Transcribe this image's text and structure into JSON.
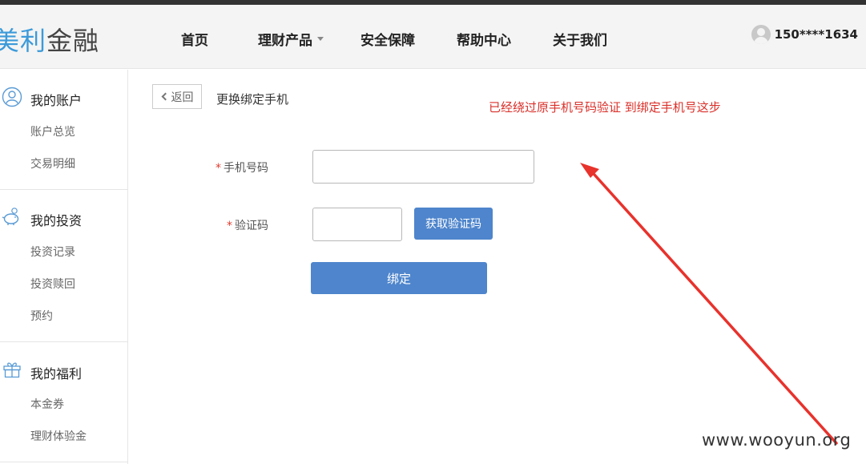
{
  "header": {
    "logo_part1": "美利",
    "logo_part2": "金融",
    "nav": [
      {
        "label": "首页"
      },
      {
        "label": "理财产品"
      },
      {
        "label": "安全保障"
      },
      {
        "label": "帮助中心"
      },
      {
        "label": "关于我们"
      }
    ],
    "user_phone": "150****1634"
  },
  "sidebar": {
    "groups": [
      {
        "title": "我的账户",
        "icon": "user-icon",
        "items": [
          "账户总览",
          "交易明细"
        ]
      },
      {
        "title": "我的投资",
        "icon": "piggy-bank-icon",
        "items": [
          "投资记录",
          "投资赎回",
          "预约"
        ]
      },
      {
        "title": "我的福利",
        "icon": "gift-icon",
        "items": [
          "本金券",
          "理财体验金"
        ]
      }
    ]
  },
  "main": {
    "back_label": "返回",
    "title": "更换绑定手机",
    "annotation": "已经绕过原手机号码验证 到绑定手机号这步",
    "form": {
      "phone_label": "手机号码",
      "phone_value": "",
      "code_label": "验证码",
      "code_value": "",
      "get_code_label": "获取验证码",
      "submit_label": "绑定"
    }
  },
  "watermark": "www.wooyun.org",
  "colors": {
    "accent": "#4e85cc",
    "logo_blue": "#3c9ad9",
    "annotation_red": "#d9302a"
  }
}
